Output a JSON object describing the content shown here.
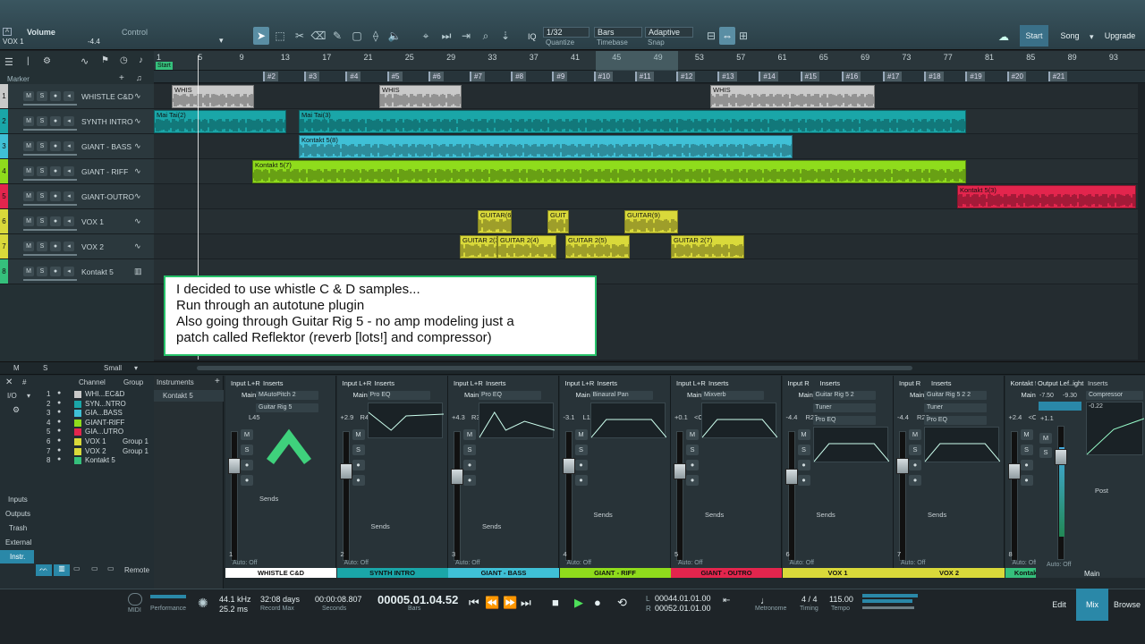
{
  "toolbar": {
    "title": "Volume",
    "control_label": "Control",
    "track": "VOX 1",
    "value": "-4.4",
    "quantize_value": "1/32",
    "quantize_label": "Quantize",
    "timebase_value": "Bars",
    "timebase_label": "Timebase",
    "snap_value": "Adaptive",
    "snap_label": "Snap",
    "iq": "IQ",
    "start": "Start",
    "song": "Song",
    "upgrade": "Upgrade"
  },
  "ruler": {
    "ticks": [
      "1",
      "5",
      "9",
      "13",
      "17",
      "21",
      "25",
      "29",
      "33",
      "37",
      "41",
      "45",
      "49",
      "53",
      "57",
      "61",
      "65",
      "69",
      "73",
      "77",
      "81",
      "85",
      "89",
      "93"
    ],
    "start": "Start"
  },
  "markers": {
    "label": "Marker",
    "items": [
      "#2",
      "#3",
      "#4",
      "#5",
      "#6",
      "#7",
      "#8",
      "#9",
      "#10",
      "#11",
      "#12",
      "#13",
      "#14",
      "#15",
      "#16",
      "#17",
      "#18",
      "#19",
      "#20",
      "#21"
    ]
  },
  "tracks": [
    {
      "num": "1",
      "name": "WHISTLE C&D",
      "color": "#c9c9c9"
    },
    {
      "num": "2",
      "name": "SYNTH INTRO",
      "color": "#1aa6a8"
    },
    {
      "num": "3",
      "name": "GIANT - BASS",
      "color": "#3fc0d6"
    },
    {
      "num": "4",
      "name": "GIANT - RIFF",
      "color": "#8fdc1c"
    },
    {
      "num": "5",
      "name": "GIANT-OUTRO",
      "color": "#e3254d"
    },
    {
      "num": "6",
      "name": "VOX 1",
      "color": "#d9d93a"
    },
    {
      "num": "7",
      "name": "VOX 2",
      "color": "#d9d93a"
    },
    {
      "num": "8",
      "name": "Kontakt 5",
      "color": "#35c07c"
    }
  ],
  "track_buttons": {
    "m": "M",
    "s": "S"
  },
  "clips": {
    "whis": "WHIS",
    "synth1": "Mai Tai(2)",
    "synth2": "Mai Tai(3)",
    "bass": "Kontakt 5(8)",
    "riff": "Kontakt 5(7)",
    "outro": "Kontakt 5(3)",
    "vox1a": "GUITAR(6)",
    "vox1b": "GUIT",
    "vox1c": "GUITAR(9)",
    "vox2a": "GUITAR 2(3)",
    "vox2b": "GUITAR 2(4)",
    "vox2c": "GUITAR 2(5)",
    "vox2d": "GUITAR 2(7)"
  },
  "arrange_footer": {
    "m": "M",
    "s": "S",
    "size": "Small"
  },
  "note": {
    "l1": "I decided to use whistle C & D samples...",
    "l2": "Run through an autotune plugin",
    "l3": "Also going through Guitar Rig 5 - no amp modeling just a",
    "l4": "patch called Reflektor (reverb [lots!] and compressor)"
  },
  "mixer": {
    "io": "I/O",
    "channel": "Channel",
    "group": "Group",
    "instruments": "Instruments",
    "inst_item": "Kontakt 5",
    "channels": [
      {
        "n": "1",
        "name": "WHI...EC&D",
        "group": ""
      },
      {
        "n": "2",
        "name": "SYN...NTRO",
        "group": ""
      },
      {
        "n": "3",
        "name": "GIA...BASS",
        "group": ""
      },
      {
        "n": "4",
        "name": "GIANT-RIFF",
        "group": ""
      },
      {
        "n": "5",
        "name": "GIA...UTRO",
        "group": ""
      },
      {
        "n": "6",
        "name": "VOX 1",
        "group": "Group 1"
      },
      {
        "n": "7",
        "name": "VOX 2",
        "group": "Group 1"
      },
      {
        "n": "8",
        "name": "Kontakt 5",
        "group": ""
      }
    ],
    "side": {
      "inputs": "Inputs",
      "outputs": "Outputs",
      "trash": "Trash",
      "external": "External",
      "instr": "Instr.",
      "remote": "Remote"
    },
    "strips": [
      {
        "input": "Input L+R",
        "bus": "Main",
        "pan": "L45",
        "inserts": [
          "MAutoPitch 2",
          "Guitar Rig 5"
        ],
        "label": "WHISTLE C&D",
        "num": "1",
        "color": "#ffffff",
        "vol": ""
      },
      {
        "input": "Input L+R",
        "bus": "Main",
        "pan": "R42",
        "inserts": [
          "Pro EQ"
        ],
        "label": "SYNTH INTRO",
        "num": "2",
        "color": "#1aa6a8",
        "vol": "+2.9"
      },
      {
        "input": "Input L+R",
        "bus": "Main",
        "pan": "R32",
        "inserts": [
          "Pro EQ",
          "Compressor"
        ],
        "label": "GIANT - BASS",
        "num": "3",
        "color": "#3fc0d6",
        "vol": "+4.3"
      },
      {
        "input": "Input L+R",
        "bus": "Main",
        "pan": "L11",
        "inserts": [
          "Binaural Pan",
          "Pro EQ"
        ],
        "label": "GIANT - RIFF",
        "num": "4",
        "color": "#8fdc1c",
        "vol": "-3.1"
      },
      {
        "input": "Input L+R",
        "bus": "Main",
        "pan": "<C>",
        "inserts": [
          "Mixverb",
          "Pro EQ"
        ],
        "label": "GIANT - OUTRO",
        "num": "5",
        "color": "#e3254d",
        "vol": "+0.1"
      },
      {
        "input": "Input R",
        "bus": "Main",
        "pan": "R29",
        "inserts": [
          "Guitar Rig 5 2",
          "Tuner",
          "Pro EQ"
        ],
        "label": "VOX 1",
        "num": "6",
        "color": "#d9d93a",
        "vol": "-4.4"
      },
      {
        "input": "Input R",
        "bus": "Main",
        "pan": "R26",
        "inserts": [
          "Guitar Rig 5 2 2",
          "Tuner",
          "Pro EQ"
        ],
        "label": "VOX 2",
        "num": "7",
        "color": "#d9d93a",
        "vol": "-4.4"
      },
      {
        "input": "Kontakt 5",
        "bus": "Main",
        "pan": "<C>",
        "inserts": [],
        "label": "Kontakt 5",
        "num": "8",
        "color": "#35c07c",
        "vol": "+2.4"
      }
    ],
    "inserts_label": "Inserts",
    "sends_label": "Sends",
    "auto_off": "Auto: Off",
    "master": {
      "output": "Output Lef..ight",
      "l": "-7.50",
      "r": "-9.30",
      "vol": "+1.1",
      "insert": "Compressor",
      "post": "Post",
      "main": "Main",
      "auto": "Auto: Off",
      "m": "M",
      "s": "S",
      "comp_value": "-0.22"
    }
  },
  "transport": {
    "midi": "MIDI",
    "performance": "Performance",
    "rate": "44.1 kHz",
    "latency": "25.2 ms",
    "record_max_value": "32:08 days",
    "record_max": "Record Max",
    "seconds_value": "00:00:08.807",
    "seconds": "Seconds",
    "bars_value": "00005.01.04.52",
    "bars": "Bars",
    "loop_l": "00044.01.01.00",
    "loop_r": "00052.01.01.00",
    "metronome": "Metronome",
    "timing": "Timing",
    "timing_value": "4 / 4",
    "tempo": "Tempo",
    "tempo_value": "115.00",
    "edit": "Edit",
    "mix": "Mix",
    "browse": "Browse",
    "l": "L",
    "r": "R"
  },
  "colors": {
    "accent": "#2aa8c8",
    "selection_green": "#26c26a"
  }
}
